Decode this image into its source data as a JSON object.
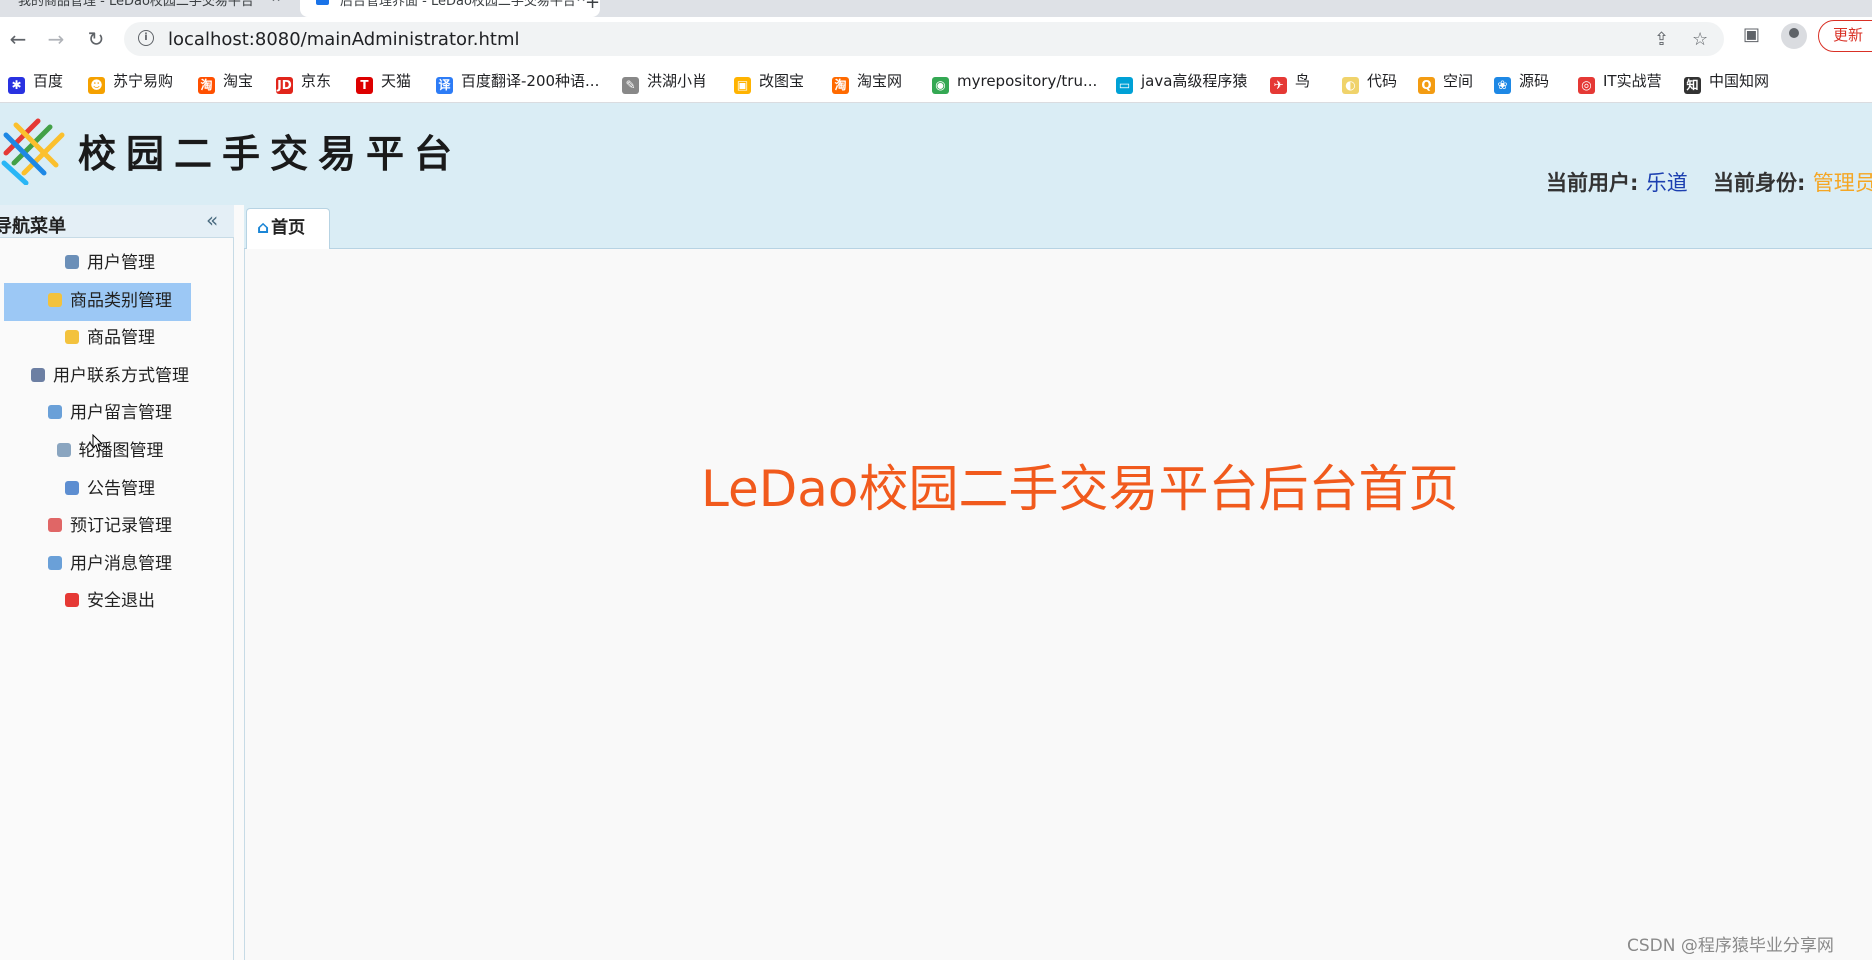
{
  "browser": {
    "tabs": [
      {
        "label": "我的商品管理 - LeDao校园二手交易平台"
      },
      {
        "label": "后台管理界面 - LeDao校园二手交易平台"
      }
    ],
    "url": "localhost:8080/mainAdministrator.html",
    "update_label": "更新",
    "bookmarks": [
      {
        "label": "百度",
        "color": "#2932e1",
        "glyph": "✱"
      },
      {
        "label": "苏宁易购",
        "color": "#f5a100",
        "glyph": "☻"
      },
      {
        "label": "淘宝",
        "color": "#ff5000",
        "glyph": "淘"
      },
      {
        "label": "京东",
        "color": "#e1251b",
        "glyph": "JD"
      },
      {
        "label": "天猫",
        "color": "#d00",
        "glyph": "T"
      },
      {
        "label": "百度翻译-200种语...",
        "color": "#2d7cf6",
        "glyph": "译"
      },
      {
        "label": "洪湖小肖",
        "color": "#888",
        "glyph": "✎"
      },
      {
        "label": "改图宝",
        "color": "#ffb300",
        "glyph": "▣"
      },
      {
        "label": "淘宝网",
        "color": "#ff6a00",
        "glyph": "淘"
      },
      {
        "label": "myrepository/tru...",
        "color": "#34a853",
        "glyph": "◉"
      },
      {
        "label": "java高级程序猿",
        "color": "#00a1d6",
        "glyph": "▭"
      },
      {
        "label": "鸟",
        "color": "#e53935",
        "glyph": "✈"
      },
      {
        "label": "代码",
        "color": "#f0d36b",
        "glyph": "◐"
      },
      {
        "label": "空间",
        "color": "#f39c12",
        "glyph": "Q"
      },
      {
        "label": "源码",
        "color": "#1e88e5",
        "glyph": "❀"
      },
      {
        "label": "IT实战营",
        "color": "#e53935",
        "glyph": "◎"
      },
      {
        "label": "中国知网",
        "color": "#333",
        "glyph": "知"
      }
    ]
  },
  "header": {
    "logo_text": "校园二手交易平台",
    "current_user_label": "当前用户:",
    "current_user": "乐道",
    "current_role_label": "当前身份:",
    "current_role": "管理员"
  },
  "sidebar": {
    "title": "导航菜单",
    "collapse_glyph": "«",
    "items": [
      {
        "label": "用户管理",
        "icon_color": "#6b8fb8",
        "selected": false
      },
      {
        "label": "商品类别管理",
        "icon_color": "#f3c23d",
        "selected": true
      },
      {
        "label": "商品管理",
        "icon_color": "#f3c23d",
        "selected": false
      },
      {
        "label": "用户联系方式管理",
        "icon_color": "#6c7fa3",
        "selected": false
      },
      {
        "label": "用户留言管理",
        "icon_color": "#6aa0d8",
        "selected": false
      },
      {
        "label": "轮播图管理",
        "icon_color": "#8aa5c0",
        "selected": false
      },
      {
        "label": "公告管理",
        "icon_color": "#5d8ed1",
        "selected": false
      },
      {
        "label": "预订记录管理",
        "icon_color": "#e06666",
        "selected": false
      },
      {
        "label": "用户消息管理",
        "icon_color": "#6aa0d8",
        "selected": false
      },
      {
        "label": "安全退出",
        "icon_color": "#e53935",
        "selected": false
      }
    ]
  },
  "content": {
    "tab_label": "首页",
    "welcome_text": "LeDao校园二手交易平台后台首页"
  },
  "watermark": "CSDN @程序猿毕业分享网"
}
